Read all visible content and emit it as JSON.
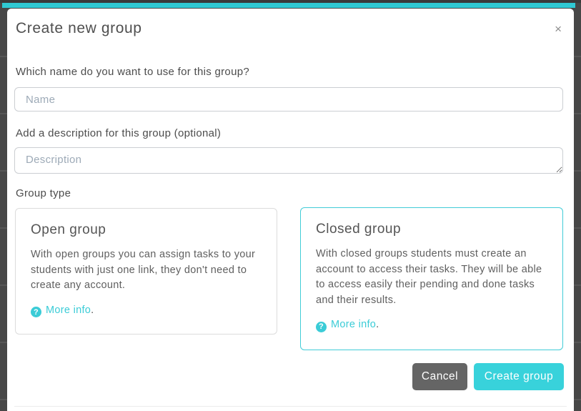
{
  "colors": {
    "teal_bar": "#2fc9d3",
    "teal_accent": "#3bccd7",
    "create_button": "#38d2db",
    "cancel_button": "#656565",
    "overlay_dark": "#474747"
  },
  "modal": {
    "title": "Create new group",
    "close_icon": "×",
    "name_question": "Which name do you want to use for this group?",
    "name_placeholder": "Name",
    "name_value": "",
    "description_label": "Add a description for this group (optional)",
    "description_placeholder": "Description",
    "description_value": "",
    "group_type_label": "Group type",
    "help_icon": "?",
    "cards": [
      {
        "title": "Open group",
        "body": "With open groups you can assign tasks to your students with just one link, they don't need to create any account.",
        "link": "More info",
        "period": ".",
        "selected": false
      },
      {
        "title": "Closed group",
        "body": "With closed groups students must create an account to access their tasks. They will be able to access easily their pending and done tasks and their results.",
        "link": "More info",
        "period": ".",
        "selected": true
      }
    ],
    "buttons": {
      "cancel": "Cancel",
      "create": "Create group"
    }
  }
}
